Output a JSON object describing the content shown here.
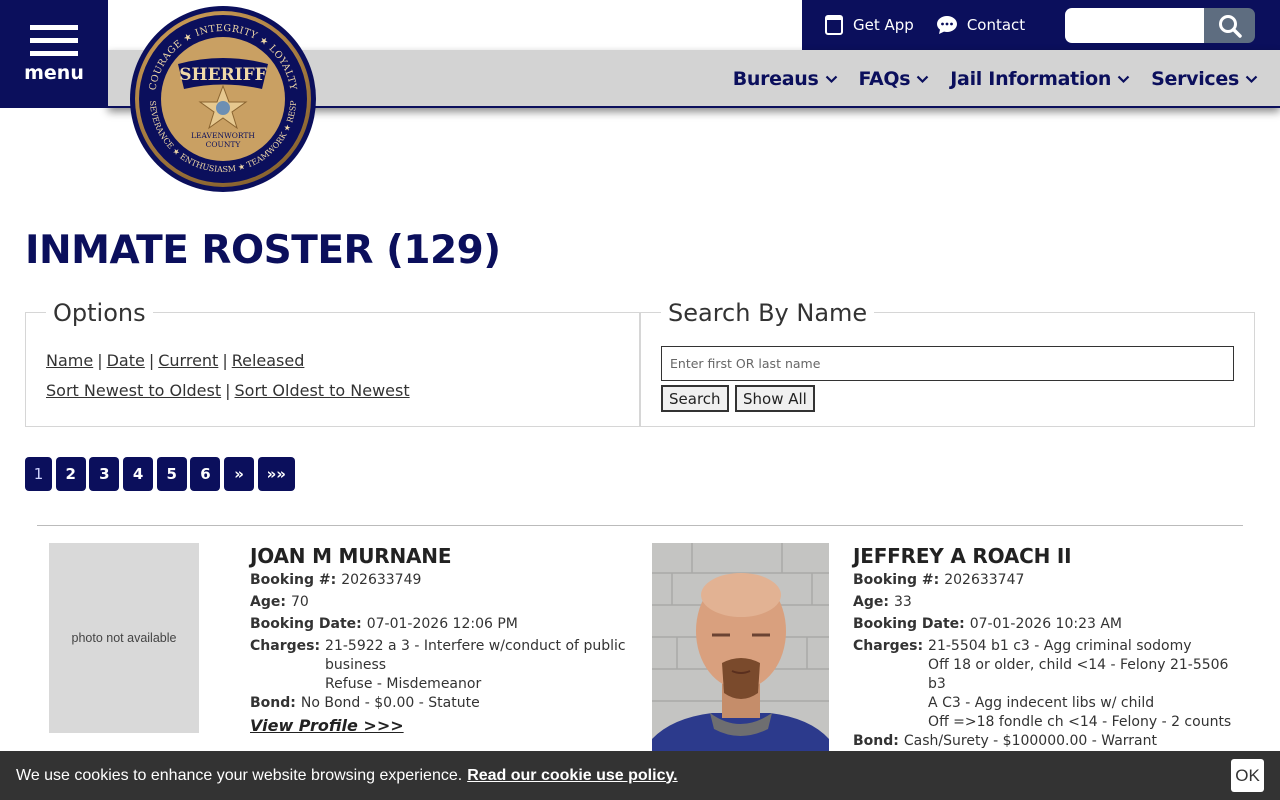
{
  "header": {
    "menu_label": "menu",
    "top_links": {
      "get_app": "Get App",
      "contact": "Contact"
    },
    "search": {
      "placeholder": ""
    },
    "nav": [
      "Bureaus",
      "FAQs",
      "Jail Information",
      "Services"
    ],
    "badge": {
      "title": "SHERIFF",
      "ring_top": "COURAGE ★ INTEGRITY ★ LOYALTY",
      "ring_bottom": "PERSEVERANCE ★ ENTHUSIASM ★ TEAMWORK ★ RESPECT",
      "county_line1": "LEAVENWORTH",
      "county_line2": "COUNTY"
    }
  },
  "page": {
    "title": "INMATE ROSTER (129)"
  },
  "options": {
    "legend": "Options",
    "sort_links": [
      "Name",
      "Date",
      "Current",
      "Released"
    ],
    "order_links": [
      "Sort Newest to Oldest",
      "Sort Oldest to Newest"
    ]
  },
  "search_by_name": {
    "legend": "Search By Name",
    "placeholder": "Enter first OR last name",
    "search_label": "Search",
    "show_all_label": "Show All"
  },
  "pagination": {
    "current": "1",
    "pages": [
      "2",
      "3",
      "4",
      "5",
      "6"
    ],
    "next": "»",
    "last": "»»"
  },
  "labels": {
    "booking": "Booking #:",
    "age": "Age:",
    "booking_date": "Booking Date:",
    "charges": "Charges:",
    "bond": "Bond:",
    "view_profile": "View Profile >>>"
  },
  "inmates": [
    {
      "name": "JOAN M MURNANE",
      "photo": "photo not available",
      "booking_number": "202633749",
      "age": "70",
      "booking_date": "07-01-2026 12:06 PM",
      "charges": [
        "21-5922 a 3 - Interfere w/conduct of public",
        "business",
        "Refuse - Misdemeanor"
      ],
      "bond": "No Bond - $0.00 - Statute"
    },
    {
      "name": "JEFFREY A ROACH II",
      "photo": "",
      "booking_number": "202633747",
      "age": "33",
      "booking_date": "07-01-2026 10:23 AM",
      "charges": [
        "21-5504 b1 c3 - Agg criminal sodomy",
        "Off 18 or older, child <14 - Felony 21-5506 b3",
        "A C3 - Agg indecent libs w/ child",
        "Off =>18 fondle ch <14 - Felony - 2 counts"
      ],
      "bond": "Cash/Surety - $100000.00 - Warrant"
    }
  ],
  "cookie": {
    "text": "We use cookies to enhance your website browsing experience.",
    "link": "Read our cookie use policy.",
    "ok": "OK"
  },
  "colors": {
    "navy": "#0b0f5c",
    "nav_bg": "#d3d3d3",
    "cookie_bg": "#333333",
    "search_btn": "#5e6d80"
  }
}
